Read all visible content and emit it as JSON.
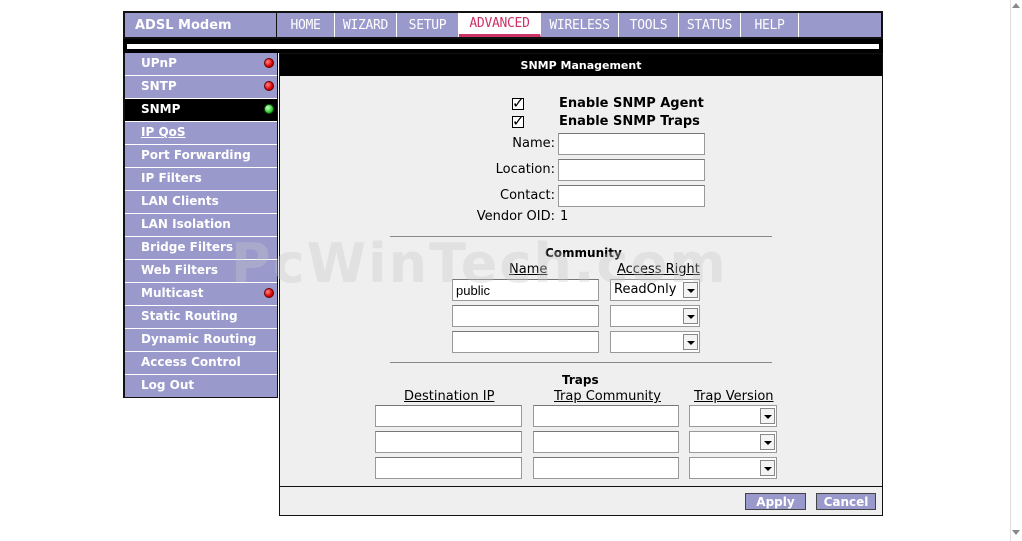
{
  "header": {
    "brand": "ADSL Modem",
    "tabs": [
      {
        "label": "HOME"
      },
      {
        "label": "WIZARD"
      },
      {
        "label": "SETUP"
      },
      {
        "label": "ADVANCED"
      },
      {
        "label": "WIRELESS"
      },
      {
        "label": "TOOLS"
      },
      {
        "label": "STATUS"
      },
      {
        "label": "HELP"
      }
    ]
  },
  "sidebar": {
    "items": [
      {
        "label": "UPnP",
        "status": "red"
      },
      {
        "label": "SNTP",
        "status": "red"
      },
      {
        "label": "SNMP",
        "status": "green"
      },
      {
        "label": "IP QoS"
      },
      {
        "label": "Port Forwarding"
      },
      {
        "label": "IP Filters"
      },
      {
        "label": "LAN Clients"
      },
      {
        "label": "LAN Isolation"
      },
      {
        "label": "Bridge Filters"
      },
      {
        "label": "Web Filters"
      },
      {
        "label": "Multicast",
        "status": "red"
      },
      {
        "label": "Static Routing"
      },
      {
        "label": "Dynamic Routing"
      },
      {
        "label": "Access Control"
      },
      {
        "label": "Log Out"
      }
    ]
  },
  "main": {
    "title": "SNMP Management",
    "enable_agent": "Enable SNMP Agent",
    "enable_traps": "Enable SNMP Traps",
    "name_label": "Name:",
    "location_label": "Location:",
    "contact_label": "Contact:",
    "vendor_oid_label": "Vendor OID:",
    "vendor_oid_value": "1",
    "community_heading": "Community",
    "community_name_col": "Name",
    "community_access_col": "Access Right",
    "community_rows": [
      {
        "name": "public",
        "access": "ReadOnly"
      },
      {
        "name": "",
        "access": ""
      },
      {
        "name": "",
        "access": ""
      }
    ],
    "traps_heading": "Traps",
    "trap_dest_col": "Destination IP",
    "trap_community_col": "Trap Community",
    "trap_version_col": "Trap Version",
    "apply": "Apply",
    "cancel": "Cancel"
  },
  "watermark": "PcWinTech.com"
}
